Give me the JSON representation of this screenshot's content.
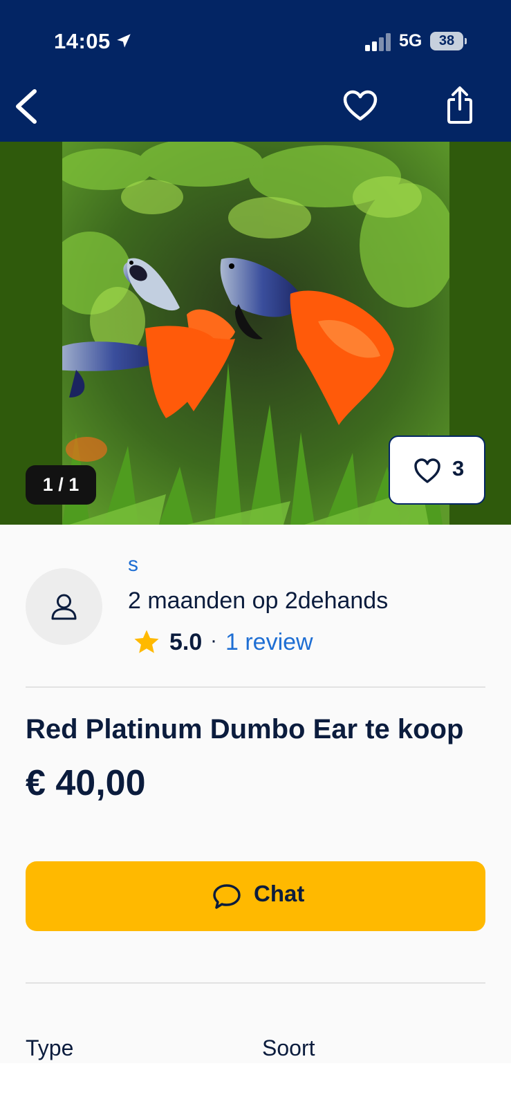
{
  "status_bar": {
    "time": "14:05",
    "network": "5G",
    "battery": "38",
    "icons": [
      "location-arrow-icon",
      "signal-icon",
      "battery-icon"
    ]
  },
  "header": {
    "icons": [
      "chevron-left-icon",
      "heart-outline-icon",
      "share-icon"
    ],
    "background": "#032564"
  },
  "gallery": {
    "counter": "1 / 1",
    "like_count": "3",
    "image_subject": "two-guppies-in-aquarium"
  },
  "seller": {
    "name": "s",
    "member_since": "2 maanden op 2dehands",
    "rating": "5.0",
    "separator": "·",
    "reviews_link": "1 review"
  },
  "listing": {
    "title": "Red Platinum Dumbo Ear te koop",
    "price": "€ 40,00"
  },
  "actions": {
    "chat_label": "Chat",
    "chat_color": "#ffb900"
  },
  "attributes": {
    "type_label": "Type",
    "soort_label": "Soort"
  },
  "colors": {
    "link_blue": "#1e6ed3",
    "text_dark": "#0b1c3d",
    "star_yellow": "#ffb900"
  }
}
